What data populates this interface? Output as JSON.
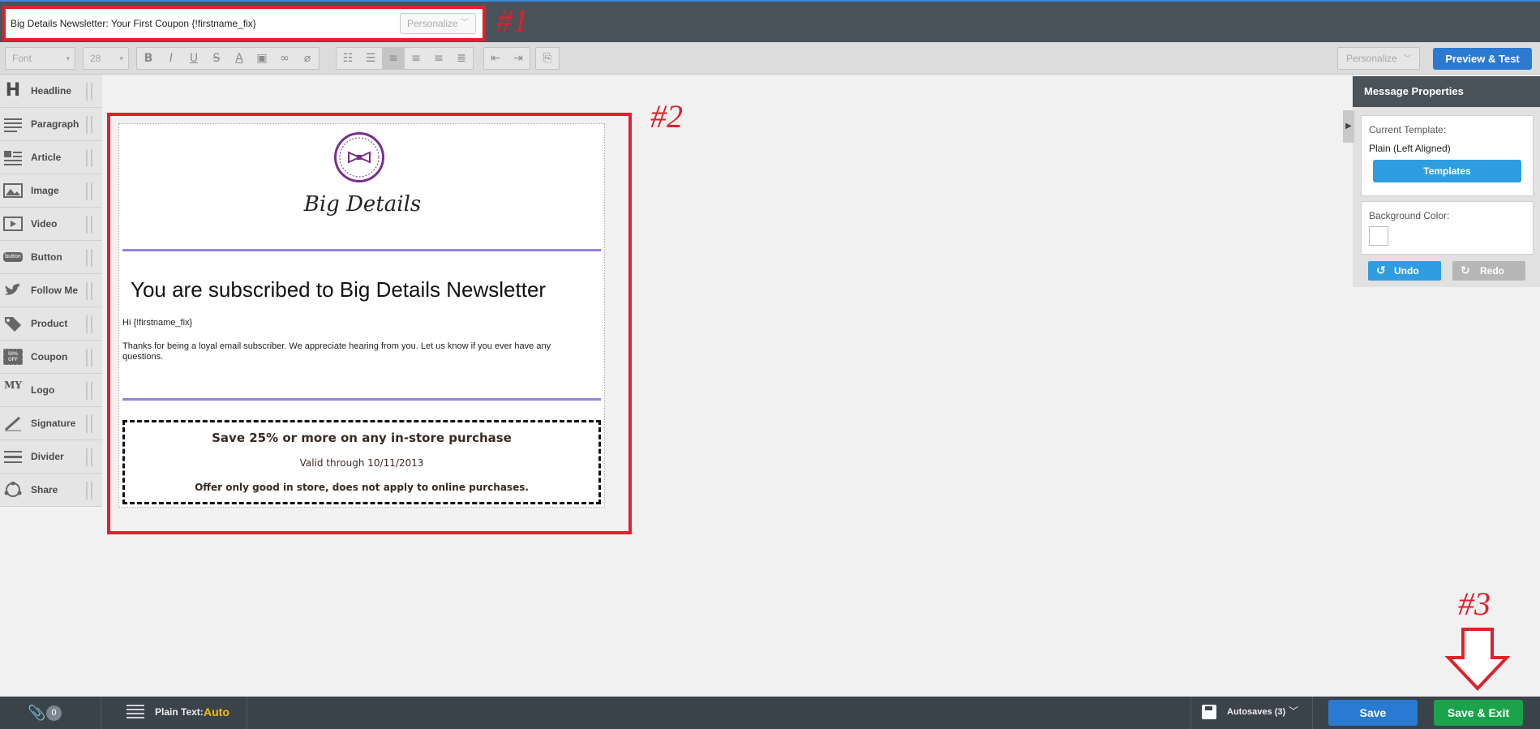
{
  "subject": {
    "value": "Big Details Newsletter: Your First Coupon {!firstname_fix}",
    "personalize_label": "Personalize"
  },
  "annotations": {
    "one": "#1",
    "two": "#2",
    "three": "#3"
  },
  "toolbar": {
    "font_select": "Font",
    "size_select": "28",
    "format_buttons": {
      "bold": "B",
      "italic": "I",
      "underline": "U",
      "strike": "S",
      "font_color": "A"
    },
    "personalize_label": "Personalize",
    "preview_label": "Preview & Test"
  },
  "sidebar": {
    "items": [
      {
        "label": "Headline",
        "icon": "headline-icon"
      },
      {
        "label": "Paragraph",
        "icon": "paragraph-icon"
      },
      {
        "label": "Article",
        "icon": "article-icon"
      },
      {
        "label": "Image",
        "icon": "image-icon"
      },
      {
        "label": "Video",
        "icon": "video-icon"
      },
      {
        "label": "Button",
        "icon": "button-icon"
      },
      {
        "label": "Follow Me",
        "icon": "twitter-icon"
      },
      {
        "label": "Product",
        "icon": "tag-icon"
      },
      {
        "label": "Coupon",
        "icon": "coupon-icon"
      },
      {
        "label": "Logo",
        "icon": "logo-icon"
      },
      {
        "label": "Signature",
        "icon": "pen-icon"
      },
      {
        "label": "Divider",
        "icon": "divider-icon"
      },
      {
        "label": "Share",
        "icon": "share-icon"
      }
    ],
    "icon_text": {
      "headline": "H",
      "logo": "MY",
      "button": "button",
      "coupon": "50% OFF"
    }
  },
  "email": {
    "logo_text": "Big Details",
    "headline": "You are subscribed to Big Details Newsletter",
    "greeting": "Hi {!firstname_fix}",
    "body": "Thanks for being a loyal email subscriber. We appreciate hearing from you. Let us know if you ever have any questions.",
    "coupon": {
      "title": "Save 25% or more on any in-store purchase",
      "valid": "Valid through 10/11/2013",
      "terms": "Offer only good in store, does not apply to online purchases."
    },
    "divider_color": "#8f86e0",
    "logo_color": "#7a2e8a"
  },
  "panel": {
    "title": "Message Properties",
    "current_template_label": "Current Template:",
    "current_template_value": "Plain (Left Aligned)",
    "templates_button": "Templates",
    "background_label": "Background Color:",
    "undo_label": "Undo",
    "redo_label": "Redo"
  },
  "bottombar": {
    "attachments_count": "0",
    "plain_text_label": "Plain Text:",
    "plain_text_value": "Auto",
    "autosaves_label": "Autosaves (3)",
    "save_label": "Save",
    "save_exit_label": "Save & Exit"
  },
  "colors": {
    "annotation_red": "#e0202a",
    "primary_blue": "#2a7ad2",
    "green": "#1aa34a",
    "topbar": "#4a525a"
  }
}
